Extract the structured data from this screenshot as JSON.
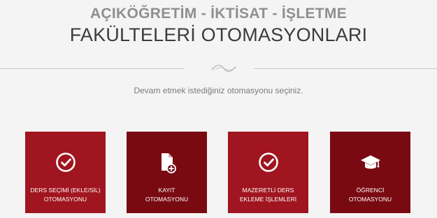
{
  "header": {
    "title_line1": "AÇIKÖĞRETİM - İKTİSAT - İŞLETME",
    "title_line2": "FAKÜLTELERİ OTOMASYONLARI"
  },
  "subtitle": "Devam etmek istediğiniz otomasyonu seçiniz.",
  "tiles": [
    {
      "icon": "check-circle-icon",
      "lines": [
        "DERS SEÇİMİ (EKLE/SİL)",
        "OTOMASYONU"
      ],
      "color": "#a0151f"
    },
    {
      "icon": "file-plus-icon",
      "lines": [
        "KAYIT",
        "OTOMASYONU"
      ],
      "color": "#7a0a12"
    },
    {
      "icon": "check-circle-icon",
      "lines": [
        "MAZERETLİ DERS",
        "EKLEME İŞLEMLERİ"
      ],
      "color": "#a0151f"
    },
    {
      "icon": "graduation-cap-icon",
      "lines": [
        "ÖĞRENCİ",
        "OTOMASYONU"
      ],
      "color": "#7a0a12"
    }
  ]
}
